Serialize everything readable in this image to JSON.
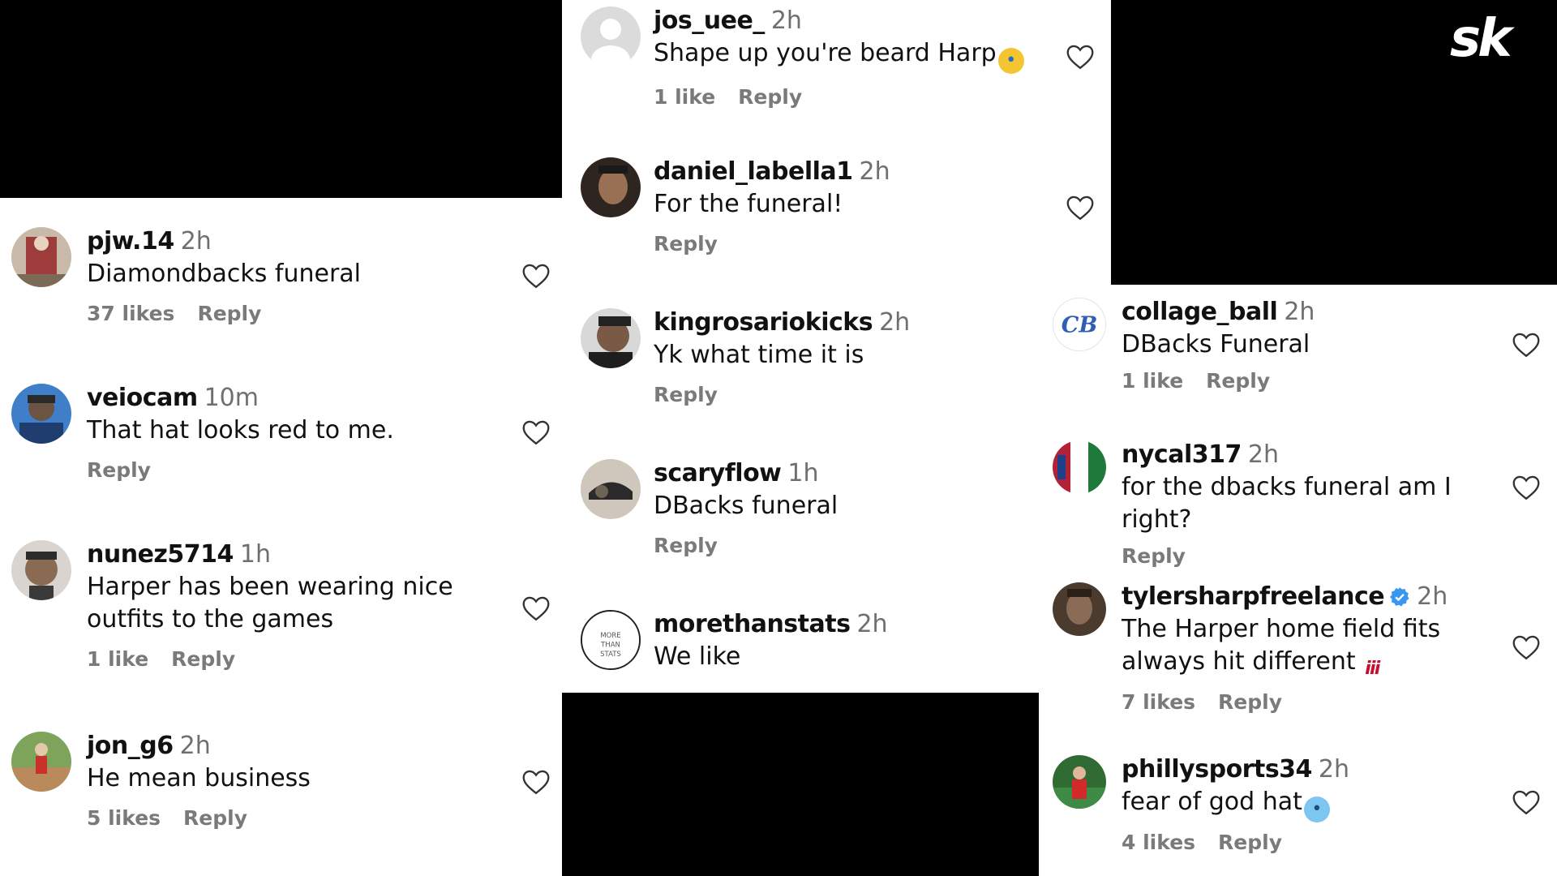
{
  "brand": {
    "logo_text": "sk"
  },
  "left": [
    {
      "username": "pjw.14",
      "time": "2h",
      "text": "Diamondbacks funeral",
      "likes": "37 likes",
      "reply": "Reply",
      "avatar_color": "#9e3b3b"
    },
    {
      "username": "veiocam",
      "time": "10m",
      "text": "That hat looks red to me.",
      "likes": "",
      "reply": "Reply",
      "avatar_color": "#2d5fa8"
    },
    {
      "username": "nunez5714",
      "time": "1h",
      "text": "Harper has been wearing nice outfits to the games",
      "likes": "1 like",
      "reply": "Reply",
      "avatar_color": "#5a4a3e"
    },
    {
      "username": "jon_g6",
      "time": "2h",
      "text": "He mean business",
      "likes": "5 likes",
      "reply": "Reply",
      "avatar_color": "#6d8f3e"
    }
  ],
  "middle": [
    {
      "username": "jos_uee_",
      "time": "2h",
      "text": "Shape up you're beard Harp",
      "emoji": "crying-face",
      "likes": "1 like",
      "reply": "Reply",
      "avatar_color": "#dcdcdc"
    },
    {
      "username": "daniel_labella1",
      "time": "2h",
      "text": "For the funeral!",
      "likes": "",
      "reply": "Reply",
      "avatar_color": "#4b3a30"
    },
    {
      "username": "kingrosariokicks",
      "time": "2h",
      "text": "Yk what time it is",
      "likes": "",
      "reply": "Reply",
      "avatar_color": "#3a3a3a"
    },
    {
      "username": "scaryflow",
      "time": "1h",
      "text": "DBacks funeral",
      "likes": "",
      "reply": "Reply",
      "avatar_color": "#8a8070"
    },
    {
      "username": "morethanstats",
      "time": "2h",
      "text": "We like",
      "likes": "",
      "reply": "",
      "avatar_color": "#ffffff",
      "avatar_text": "MORE THAN STATS"
    }
  ],
  "right": [
    {
      "username": "collage_ball",
      "time": "2h",
      "text": "DBacks Funeral",
      "likes": "1 like",
      "reply": "Reply",
      "avatar_color": "#ffffff",
      "avatar_text": "CB"
    },
    {
      "username": "nycal317",
      "time": "2h",
      "text": "for the dbacks funeral am I right?",
      "likes": "",
      "reply": "Reply",
      "avatar_color": "#b22234"
    },
    {
      "username": "tylersharpfreelance",
      "time": "2h",
      "verified": true,
      "text": "The Harper home field fits always hit different",
      "emoji": "hundred-points",
      "likes": "7 likes",
      "reply": "Reply",
      "avatar_color": "#5b4636"
    },
    {
      "username": "phillysports34",
      "time": "2h",
      "text": "fear of god hat",
      "emoji": "cold-face",
      "likes": "4 likes",
      "reply": "Reply",
      "avatar_color": "#2f6b33"
    }
  ],
  "colors": {
    "text": "#111111",
    "muted": "#7a7a7a",
    "verified": "#3897f0",
    "background": "#000000",
    "panel": "#ffffff"
  }
}
